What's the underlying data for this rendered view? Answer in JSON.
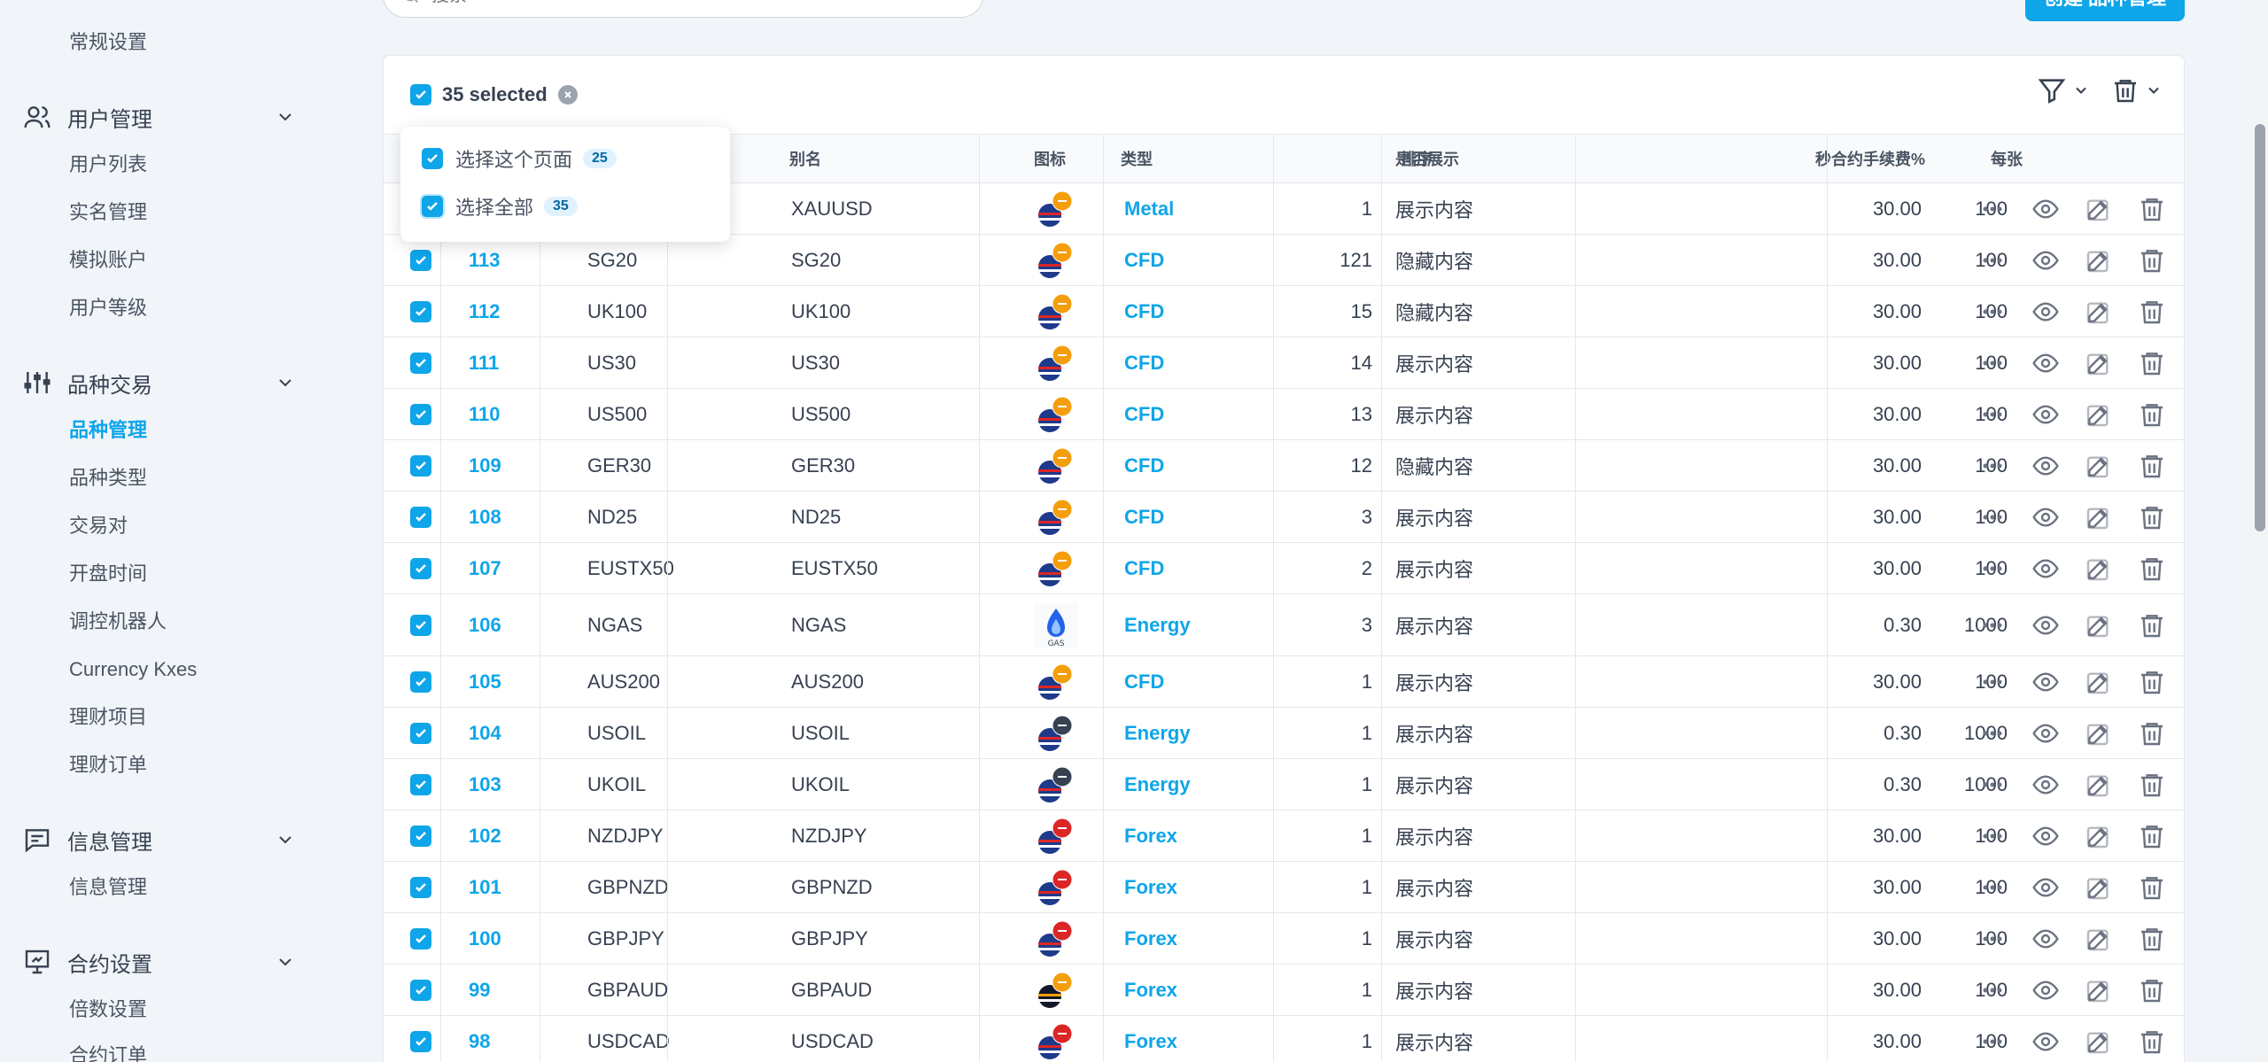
{
  "sidebar": {
    "top_item": "常规设置",
    "groups": [
      {
        "label": "用户管理",
        "icon": "users-icon",
        "items": [
          "用户列表",
          "实名管理",
          "模拟账户",
          "用户等级"
        ]
      },
      {
        "label": "品种交易",
        "icon": "sliders-icon",
        "items": [
          "品种管理",
          "品种类型",
          "交易对",
          "开盘时间",
          "调控机器人",
          "Currency Kxes",
          "理财项目",
          "理财订单"
        ]
      },
      {
        "label": "信息管理",
        "icon": "message-icon",
        "items": [
          "信息管理"
        ]
      },
      {
        "label": "合约设置",
        "icon": "presentation-icon",
        "items": [
          "倍数设置",
          "合约订单"
        ]
      }
    ],
    "active_item": "品种管理"
  },
  "search": {
    "placeholder": "搜索"
  },
  "create_button": "创建 品种管理",
  "selection": {
    "label": "35 selected",
    "popup": {
      "page_label": "选择这个页面",
      "page_count": "25",
      "all_label": "选择全部",
      "all_count": "35"
    }
  },
  "table": {
    "headers": {
      "alias": "别名",
      "icon": "图标",
      "type": "类型",
      "sort": "排序",
      "display": "是否展示",
      "fee": "秒合约手续费%",
      "per": "每张"
    },
    "rows": [
      {
        "id": "",
        "name": "",
        "alias": "XAUUSD",
        "icon": "us-gold-flag-icon",
        "type": "Metal",
        "sort": "1",
        "display": "展示内容",
        "fee": "30.00",
        "per": "100"
      },
      {
        "id": "113",
        "name": "SG20",
        "alias": "SG20",
        "icon": "us-cfd-flag-icon",
        "type": "CFD",
        "sort": "121",
        "display": "隐藏内容",
        "fee": "30.00",
        "per": "100"
      },
      {
        "id": "112",
        "name": "UK100",
        "alias": "UK100",
        "icon": "us-cfd-flag-icon",
        "type": "CFD",
        "sort": "15",
        "display": "隐藏内容",
        "fee": "30.00",
        "per": "100"
      },
      {
        "id": "111",
        "name": "US30",
        "alias": "US30",
        "icon": "us-cfd-flag-icon",
        "type": "CFD",
        "sort": "14",
        "display": "展示内容",
        "fee": "30.00",
        "per": "100"
      },
      {
        "id": "110",
        "name": "US500",
        "alias": "US500",
        "icon": "us-cfd-flag-icon",
        "type": "CFD",
        "sort": "13",
        "display": "展示内容",
        "fee": "30.00",
        "per": "100"
      },
      {
        "id": "109",
        "name": "GER30",
        "alias": "GER30",
        "icon": "us-cfd-flag-icon",
        "type": "CFD",
        "sort": "12",
        "display": "隐藏内容",
        "fee": "30.00",
        "per": "100"
      },
      {
        "id": "108",
        "name": "ND25",
        "alias": "ND25",
        "icon": "us-cfd-flag-icon",
        "type": "CFD",
        "sort": "3",
        "display": "展示内容",
        "fee": "30.00",
        "per": "100"
      },
      {
        "id": "107",
        "name": "EUSTX50",
        "alias": "EUSTX50",
        "icon": "us-cfd-flag-icon",
        "type": "CFD",
        "sort": "2",
        "display": "展示内容",
        "fee": "30.00",
        "per": "100"
      },
      {
        "id": "106",
        "name": "NGAS",
        "alias": "NGAS",
        "icon": "natural-gas-icon",
        "type": "Energy",
        "sort": "3",
        "display": "展示内容",
        "fee": "0.30",
        "per": "1000"
      },
      {
        "id": "105",
        "name": "AUS200",
        "alias": "AUS200",
        "icon": "us-cfd-flag-icon",
        "type": "CFD",
        "sort": "1",
        "display": "展示内容",
        "fee": "30.00",
        "per": "100"
      },
      {
        "id": "104",
        "name": "USOIL",
        "alias": "USOIL",
        "icon": "us-oil-flag-icon",
        "type": "Energy",
        "sort": "1",
        "display": "展示内容",
        "fee": "0.30",
        "per": "1000"
      },
      {
        "id": "103",
        "name": "UKOIL",
        "alias": "UKOIL",
        "icon": "uk-oil-flag-icon",
        "type": "Energy",
        "sort": "1",
        "display": "展示内容",
        "fee": "0.30",
        "per": "1000"
      },
      {
        "id": "102",
        "name": "NZDJPY",
        "alias": "NZDJPY",
        "icon": "nz-jp-flag-icon",
        "type": "Forex",
        "sort": "1",
        "display": "展示内容",
        "fee": "30.00",
        "per": "100"
      },
      {
        "id": "101",
        "name": "GBPNZD",
        "alias": "GBPNZD",
        "icon": "uk-nz-flag-icon",
        "type": "Forex",
        "sort": "1",
        "display": "展示内容",
        "fee": "30.00",
        "per": "100"
      },
      {
        "id": "100",
        "name": "GBPJPY",
        "alias": "GBPJPY",
        "icon": "uk-jp-flag-icon",
        "type": "Forex",
        "sort": "1",
        "display": "展示内容",
        "fee": "30.00",
        "per": "100"
      },
      {
        "id": "99",
        "name": "GBPAUD",
        "alias": "GBPAUD",
        "icon": "de-au-flag-icon",
        "type": "Forex",
        "sort": "1",
        "display": "展示内容",
        "fee": "30.00",
        "per": "100"
      },
      {
        "id": "98",
        "name": "USDCAD",
        "alias": "USDCAD",
        "icon": "us-ca-flag-icon",
        "type": "Forex",
        "sort": "1",
        "display": "展示内容",
        "fee": "30.00",
        "per": "100"
      }
    ]
  },
  "colors": {
    "accent": "#0ea5e9",
    "text": "#374151",
    "muted": "#9ca3af"
  }
}
